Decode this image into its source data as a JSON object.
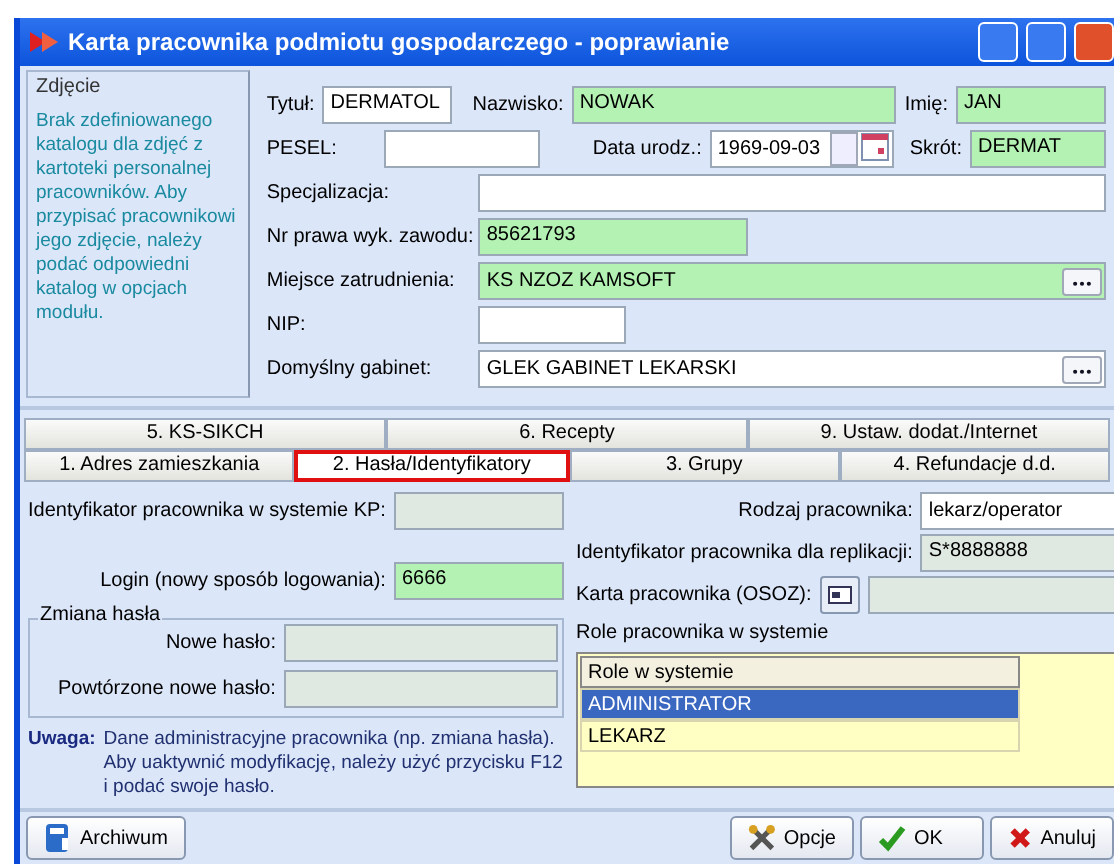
{
  "window": {
    "title": "Karta pracownika podmiotu gospodarczego - poprawianie"
  },
  "photo": {
    "title": "Zdjęcie",
    "message": "Brak zdefiniowanego katalogu dla zdjęć z kartoteki personalnej pracowników. Aby przypisać pracownikowi jego zdjęcie, należy podać odpowiedni katalog w opcjach modułu."
  },
  "person": {
    "title": {
      "label": "Tytuł:",
      "value": "DERMATOL",
      "required": false
    },
    "surname": {
      "label": "Nazwisko:",
      "value": "NOWAK",
      "required": true
    },
    "first_name": {
      "label": "Imię:",
      "value": "JAN",
      "required": true
    },
    "pesel": {
      "label": "PESEL:",
      "required": false
    },
    "birth_date": {
      "label": "Data urodz.:",
      "value": "1969-09-03"
    },
    "short": {
      "label": "Skrót:",
      "value": "DERMAT",
      "required": true
    },
    "rows": [
      {
        "label": "Specjalizacja:",
        "kind": "wide",
        "required": false
      },
      {
        "label": "Nr prawa wyk. zawodu:",
        "value": "85621793",
        "kind": "short",
        "required": true
      },
      {
        "label": "Miejsce zatrudnienia:",
        "value": "KS NZOZ KAMSOFT",
        "kind": "picker",
        "required": true
      },
      {
        "label": "NIP:",
        "kind": "tiny",
        "required": false
      },
      {
        "label": "Domyślny gabinet:",
        "value": "GLEK GABINET LEKARSKI",
        "kind": "picker",
        "required": false
      }
    ]
  },
  "tabs": [
    [
      {
        "label": "5. KS-SIKCH",
        "selected": false
      },
      {
        "label": "6. Recepty",
        "selected": false
      },
      {
        "label": "9. Ustaw. dodat./Internet",
        "selected": false
      }
    ],
    [
      {
        "label": "1. Adres zamieszkania",
        "selected": false
      },
      {
        "label": "2. Hasła/Identyfikatory",
        "selected": true
      },
      {
        "label": "3. Grupy",
        "selected": false
      },
      {
        "label": "4. Refundacje d.d.",
        "selected": false
      }
    ]
  ],
  "ids": {
    "kp": {
      "label": "Identyfikator pracownika w systemie KP:",
      "disabled": true
    },
    "login": {
      "label": "Login (nowy sposób logowania):",
      "value": "6666",
      "required": true
    },
    "employee_type": {
      "label": "Rodzaj pracownika:",
      "value": "lekarz/operator"
    },
    "replication_id": {
      "label": "Identyfikator pracownika dla replikacji:",
      "value": "S*8888888",
      "disabled": true
    },
    "card": {
      "label": "Karta pracownika (OSOZ):",
      "disabled": true
    }
  },
  "password_change": {
    "title": "Zmiana hasła",
    "fields": [
      {
        "label": "Nowe hasło:",
        "disabled": true
      },
      {
        "label": "Powtórzone nowe hasło:",
        "disabled": true
      }
    ]
  },
  "note": {
    "label": "Uwaga:",
    "text": "Dane administracyjne pracownika (np. zmiana hasła). Aby uaktywnić modyfikację, należy użyć przycisku F12 i podać swoje hasło."
  },
  "roles": {
    "title": "Role pracownika w systemie",
    "header": "Role w systemie",
    "items": [
      {
        "name": "ADMINISTRATOR",
        "selected": true
      },
      {
        "name": "LEKARZ",
        "selected": false
      }
    ]
  },
  "buttons": [
    {
      "label": "Archiwum",
      "kind": "archive"
    },
    {
      "label": "Opcje",
      "kind": "options"
    },
    {
      "label": "OK",
      "kind": "ok"
    },
    {
      "label": "Anuluj",
      "kind": "cancel"
    }
  ]
}
